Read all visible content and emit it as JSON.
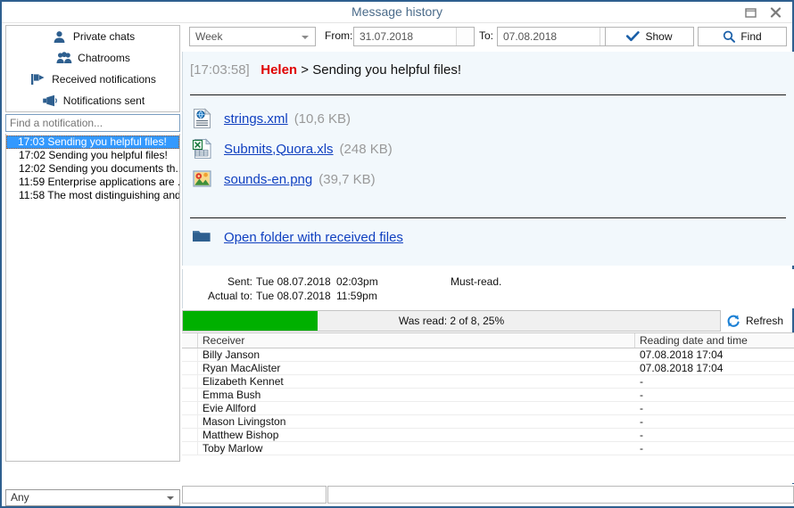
{
  "window": {
    "title": "Message history",
    "maximize_icon": "maximize-icon",
    "close_icon": "close-icon"
  },
  "sidebar": {
    "nav_items": [
      {
        "label": "Private chats",
        "icon": "user-icon"
      },
      {
        "label": "Chatrooms",
        "icon": "users-group-icon"
      },
      {
        "label": "Received notifications",
        "icon": "flag-icon"
      },
      {
        "label": "Notifications sent",
        "icon": "megaphone-icon"
      }
    ],
    "find_placeholder": "Find a notification...",
    "find_value": "",
    "notifications": [
      {
        "label": "17:03 Sending you helpful files!",
        "selected": true
      },
      {
        "label": "17:02 Sending you helpful files!",
        "selected": false
      },
      {
        "label": "12:02 Sending you documents th...",
        "selected": false
      },
      {
        "label": "11:59 Enterprise applications are ...",
        "selected": false
      },
      {
        "label": "11:58 The most distinguishing and...",
        "selected": false
      }
    ],
    "filter_select": {
      "value": "Any",
      "icon": "chevron-down-icon"
    }
  },
  "toolbar": {
    "period_select": {
      "value": "Week",
      "icon": "chevron-down-icon"
    },
    "from_label": "From:",
    "from_value": "31.07.2018",
    "to_label": "To:",
    "to_value": "07.08.2018",
    "show_button": {
      "label": "Show",
      "icon": "check-icon"
    },
    "find_button": {
      "label": "Find",
      "icon": "search-icon"
    }
  },
  "message": {
    "timestamp": "[17:03:58]",
    "sender": "Helen",
    "separator": ">",
    "text": " Sending you helpful files!",
    "files": [
      {
        "name": "strings.xml",
        "size": "(10,6 KB)",
        "icon": "xml-file-icon"
      },
      {
        "name": "Submits,Quora.xls",
        "size": "(248 KB)",
        "icon": "excel-file-icon"
      },
      {
        "name": "sounds-en.png",
        "size": "(39,7 KB)",
        "icon": "image-file-icon"
      }
    ],
    "folder_link": {
      "label": "Open folder with received files",
      "icon": "folder-icon"
    }
  },
  "meta": {
    "sent_label": "Sent:",
    "sent_date": "Tue 08.07.2018",
    "sent_time": "02:03pm",
    "actual_label": "Actual to:",
    "actual_date": "Tue 08.07.2018",
    "actual_time": "11:59pm",
    "note": "Must-read."
  },
  "progress": {
    "text": "Was read: 2 of 8, 25%",
    "percent": 25,
    "fill_color": "#00b000",
    "refresh_button": {
      "label": "Refresh",
      "icon": "refresh-icon"
    }
  },
  "table": {
    "columns": [
      "",
      "Receiver",
      "Reading date and time"
    ],
    "rows": [
      {
        "receiver": "Billy Janson",
        "read": "07.08.2018 17:04"
      },
      {
        "receiver": "Ryan MacAlister",
        "read": "07.08.2018 17:04"
      },
      {
        "receiver": "Elizabeth Kennet",
        "read": "-"
      },
      {
        "receiver": "Emma Bush",
        "read": "-"
      },
      {
        "receiver": "Evie Allford",
        "read": "-"
      },
      {
        "receiver": "Mason Livingston",
        "read": "-"
      },
      {
        "receiver": "Matthew Bishop",
        "read": "-"
      },
      {
        "receiver": "Toby Marlow",
        "read": "-"
      }
    ]
  },
  "statusbar": {
    "cell1": "",
    "cell2": ""
  }
}
